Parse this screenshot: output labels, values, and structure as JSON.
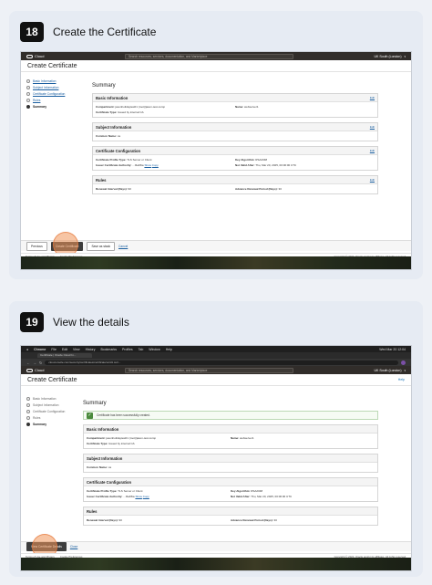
{
  "steps": [
    {
      "number": "18",
      "title": "Create the Certificate"
    },
    {
      "number": "19",
      "title": "View the details"
    }
  ],
  "shot1": {
    "console": {
      "brand": "Cloud",
      "search_placeholder": "Search resources, services, documentation, and Marketplace",
      "region": "UK South (London)"
    },
    "page_title": "Create Certificate",
    "wizard_steps": [
      "Basic Information",
      "Subject Information",
      "Certificate Configuration",
      "Rules",
      "Summary"
    ],
    "summary_heading": "Summary",
    "edit_label": "Edit",
    "sections": {
      "basic": {
        "title": "Basic Information",
        "compartment_label": "Compartment:",
        "compartment_value": "jasonholidaylew01 (root)/jason-test-comp",
        "name_label": "Name:",
        "name_value": "webserver1",
        "type_label": "Certificate Type:",
        "type_value": "Issued by internal CA"
      },
      "subject": {
        "title": "Subject Information",
        "cn_label": "Common Name:",
        "cn_value": "ca"
      },
      "config": {
        "title": "Certificate Configuration",
        "profile_label": "Certificate Profile Type:",
        "profile_value": "TLS Server or Client",
        "key_label": "Key Algorithm:",
        "key_value": "RSA2048",
        "issuer_label": "Issuer Certificate Authority:",
        "issuer_value": "...f4ab5ia",
        "show": "Show",
        "copy": "Copy",
        "notafter_label": "Not Valid After:",
        "notafter_value": "Thu, Mar 20, 2025, 00:00:00 UTC"
      },
      "rules": {
        "title": "Rules",
        "renewal_label": "Renewal Interval (Days):",
        "renewal_value": "90",
        "advance_label": "Advance Renewal Period (Days):",
        "advance_value": "30"
      }
    },
    "actions": {
      "previous": "Previous",
      "create": "Create Certificate",
      "save_stack": "Save as stack",
      "cancel": "Cancel"
    },
    "footer": {
      "terms": "Terms of Use and Privacy",
      "cookies": "Cookie Preferences",
      "copyright": "Copyright © 2024, Oracle and/or its affiliates. All rights reserved."
    }
  },
  "shot2": {
    "menubar": {
      "app": "Chrome",
      "items": [
        "File",
        "Edit",
        "View",
        "History",
        "Bookmarks",
        "Profiles",
        "Tab",
        "Window",
        "Help"
      ],
      "clock": "Wed Mar 20 12:04"
    },
    "tab_title": "Certificate | Oracle Cloud In...",
    "url": "cloud.oracle.com/security/certificates/certificate/ocid1.cert...",
    "console": {
      "brand": "Cloud",
      "search_placeholder": "Search resources, services, documentation, and Marketplace",
      "region": "UK South (London)"
    },
    "page_title": "Create Certificate",
    "help": "Help",
    "wizard_steps": [
      "Basic Information",
      "Subject Information",
      "Certificate Configuration",
      "Rules",
      "Summary"
    ],
    "summary_heading": "Summary",
    "success": "Certificate has been successfully created.",
    "sections": {
      "basic": {
        "title": "Basic Information",
        "compartment_label": "Compartment:",
        "compartment_value": "jasonholidaylew01 (root)/jason-test-comp",
        "name_label": "Name:",
        "name_value": "webserver1",
        "type_label": "Certificate Type:",
        "type_value": "Issued by internal CA"
      },
      "subject": {
        "title": "Subject Information",
        "cn_label": "Common Name:",
        "cn_value": "ca"
      },
      "config": {
        "title": "Certificate Configuration",
        "profile_label": "Certificate Profile Type:",
        "profile_value": "TLS Server or Client",
        "key_label": "Key Algorithm:",
        "key_value": "RSA2048",
        "issuer_label": "Issuer Certificate Authority:",
        "issuer_value": "...f4ab5ia",
        "show": "Show",
        "copy": "Copy",
        "notafter_label": "Not Valid After:",
        "notafter_value": "Thu, Mar 20, 2025, 00:00:00 UTC"
      },
      "rules": {
        "title": "Rules",
        "renewal_label": "Renewal Interval (Days):",
        "renewal_value": "90",
        "advance_label": "Advance Renewal Period (Days):",
        "advance_value": "30"
      }
    },
    "actions": {
      "view": "View Certificate Details",
      "close": "Close"
    },
    "footer": {
      "terms": "Terms of Use and Privacy",
      "cookies": "Cookie Preferences",
      "copyright": "Copyright © 2024, Oracle and/or its affiliates. All rights reserved."
    }
  }
}
